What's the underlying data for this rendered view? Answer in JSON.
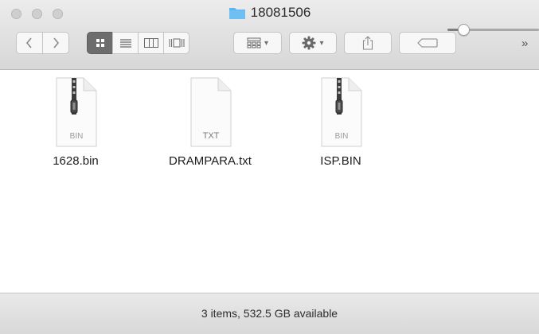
{
  "window": {
    "title": "18081506"
  },
  "toolbar": {
    "overflow_label": "»",
    "view_modes": [
      "icon-view",
      "list-view",
      "column-view",
      "cover-flow-view"
    ],
    "active_view": "icon-view"
  },
  "files": [
    {
      "name": "1628.bin",
      "type_label": "BIN",
      "kind": "archive"
    },
    {
      "name": "DRAMPARA.txt",
      "type_label": "TXT",
      "kind": "text"
    },
    {
      "name": "ISP.BIN",
      "type_label": "BIN",
      "kind": "archive"
    }
  ],
  "status": {
    "text": "3 items, 532.5 GB available",
    "icon_size_fraction": 0.17
  },
  "colors": {
    "folder": "#5fb3ea",
    "active_segment": "#6d6d6d"
  }
}
